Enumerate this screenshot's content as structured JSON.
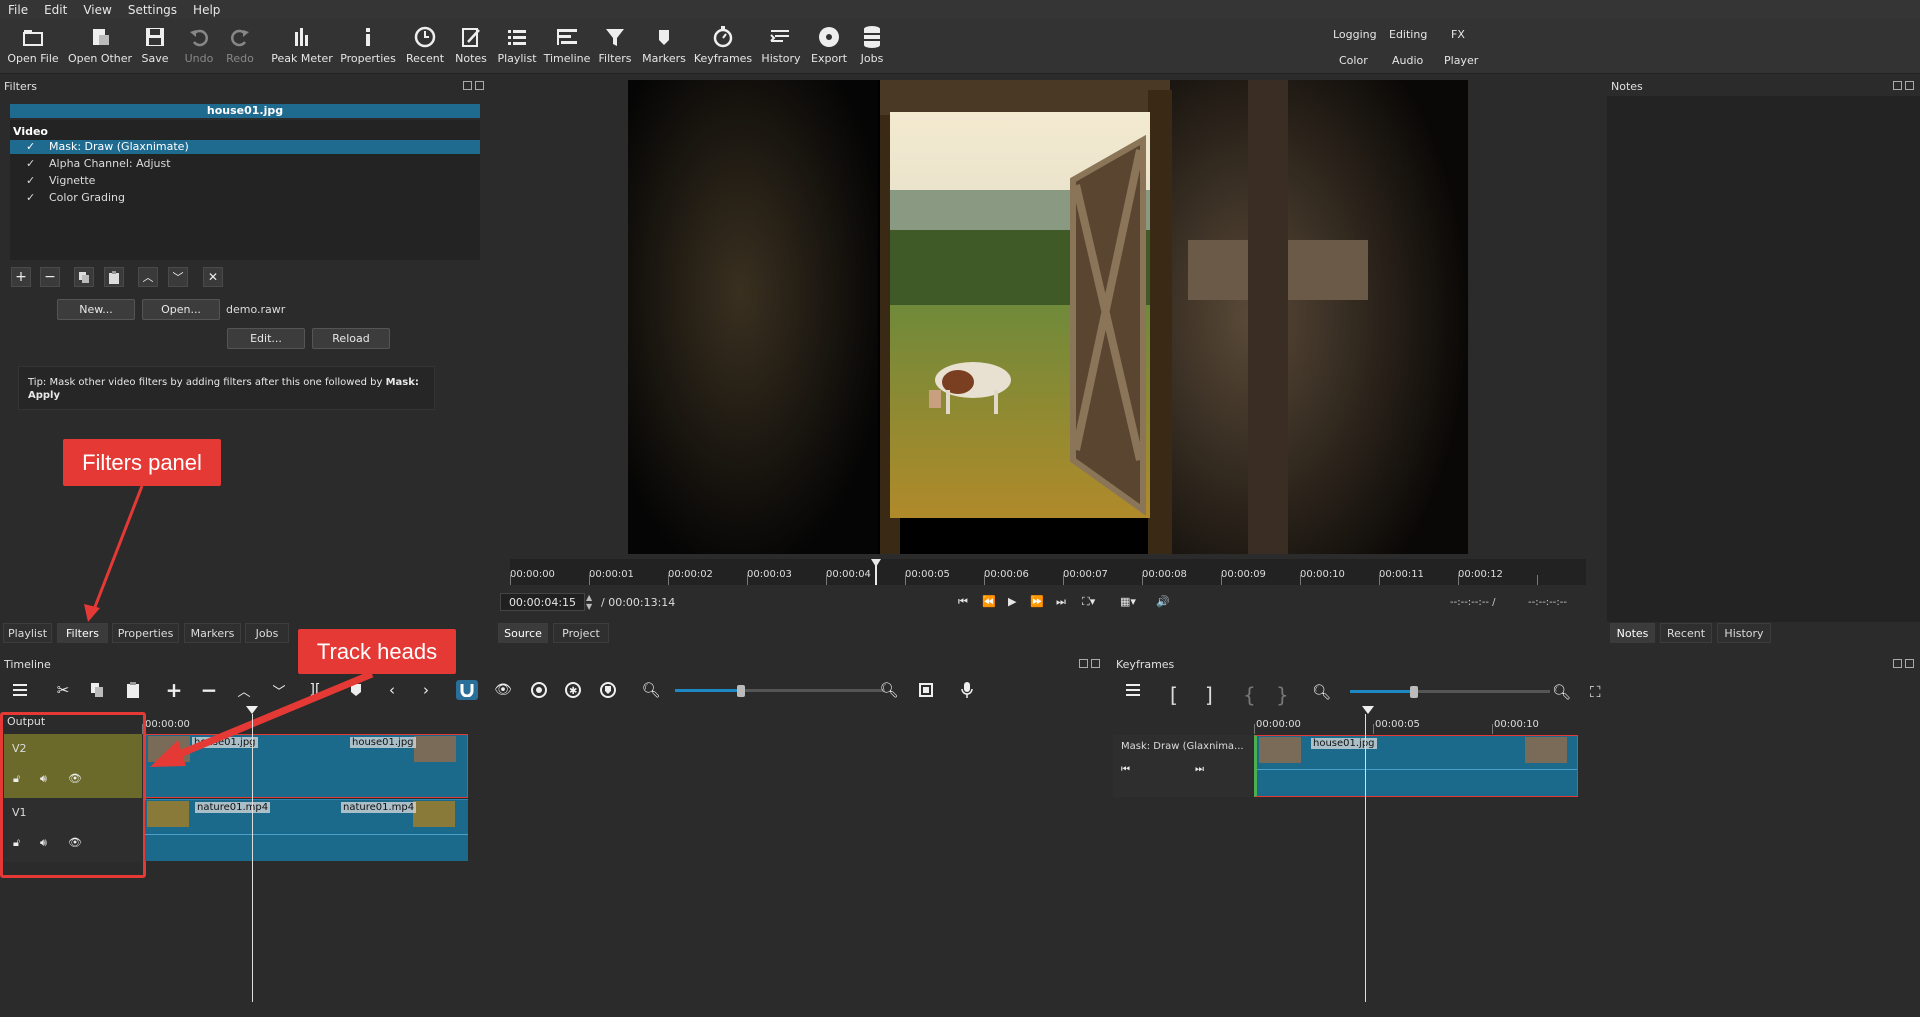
{
  "menu": [
    "File",
    "Edit",
    "View",
    "Settings",
    "Help"
  ],
  "toolbar": {
    "open_file": "Open File",
    "open_other": "Open Other",
    "save": "Save",
    "undo": "Undo",
    "redo": "Redo",
    "peak_meter": "Peak Meter",
    "properties": "Properties",
    "recent": "Recent",
    "notes": "Notes",
    "playlist": "Playlist",
    "timeline": "Timeline",
    "filters": "Filters",
    "markers": "Markers",
    "keyframes": "Keyframes",
    "history": "History",
    "export": "Export",
    "jobs": "Jobs"
  },
  "layouts": {
    "logging": "Logging",
    "editing": "Editing",
    "fx": "FX",
    "color": "Color",
    "audio": "Audio",
    "player": "Player"
  },
  "filters_panel": {
    "title": "Filters",
    "clip_name": "house01.jpg",
    "section": "Video",
    "items": [
      {
        "check": "✓",
        "name": "Mask: Draw (Glaxnimate)",
        "selected": true
      },
      {
        "check": "✓",
        "name": "Alpha Channel: Adjust",
        "selected": false
      },
      {
        "check": "✓",
        "name": "Vignette",
        "selected": false
      },
      {
        "check": "✓",
        "name": "Color Grading",
        "selected": false
      }
    ],
    "new_label": "New...",
    "open_label": "Open...",
    "file_name": "demo.rawr",
    "edit_label": "Edit...",
    "reload_label": "Reload",
    "tip_text": "Tip: Mask other video filters by adding filters after this one followed by ",
    "tip_bold": "Mask: Apply"
  },
  "callouts": {
    "filters_panel": "Filters panel",
    "track_heads": "Track heads"
  },
  "left_tabs": [
    "Playlist",
    "Filters",
    "Properties",
    "Markers",
    "Jobs"
  ],
  "viewer": {
    "ruler_labels": [
      "00:00:00",
      "00:00:01",
      "00:00:02",
      "00:00:03",
      "00:00:04",
      "00:00:05",
      "00:00:06",
      "00:00:07",
      "00:00:08",
      "00:00:09",
      "00:00:10",
      "00:00:11",
      "00:00:12"
    ],
    "current_time": "00:00:04:15",
    "duration": "/ 00:00:13:14",
    "in_point": "--:--:--:-- /",
    "out_point": "--:--:--:--",
    "source_tab": "Source",
    "project_tab": "Project"
  },
  "notes_panel": {
    "title": "Notes",
    "tabs": [
      "Notes",
      "Recent",
      "History"
    ]
  },
  "timeline": {
    "title": "Timeline",
    "output_label": "Output",
    "ruler_start": "00:00:00",
    "tracks": [
      {
        "name": "V2",
        "clip_left": "house01.jpg",
        "clip_right": "house01.jpg"
      },
      {
        "name": "V1",
        "clip_left": "nature01.mp4",
        "clip_right": "nature01.mp4"
      }
    ]
  },
  "keyframes": {
    "title": "Keyframes",
    "ruler_labels": [
      "00:00:00",
      "00:00:05",
      "00:00:10"
    ],
    "filter_name": "Mask: Draw (Glaxnima...",
    "clip_name": "house01.jpg"
  }
}
